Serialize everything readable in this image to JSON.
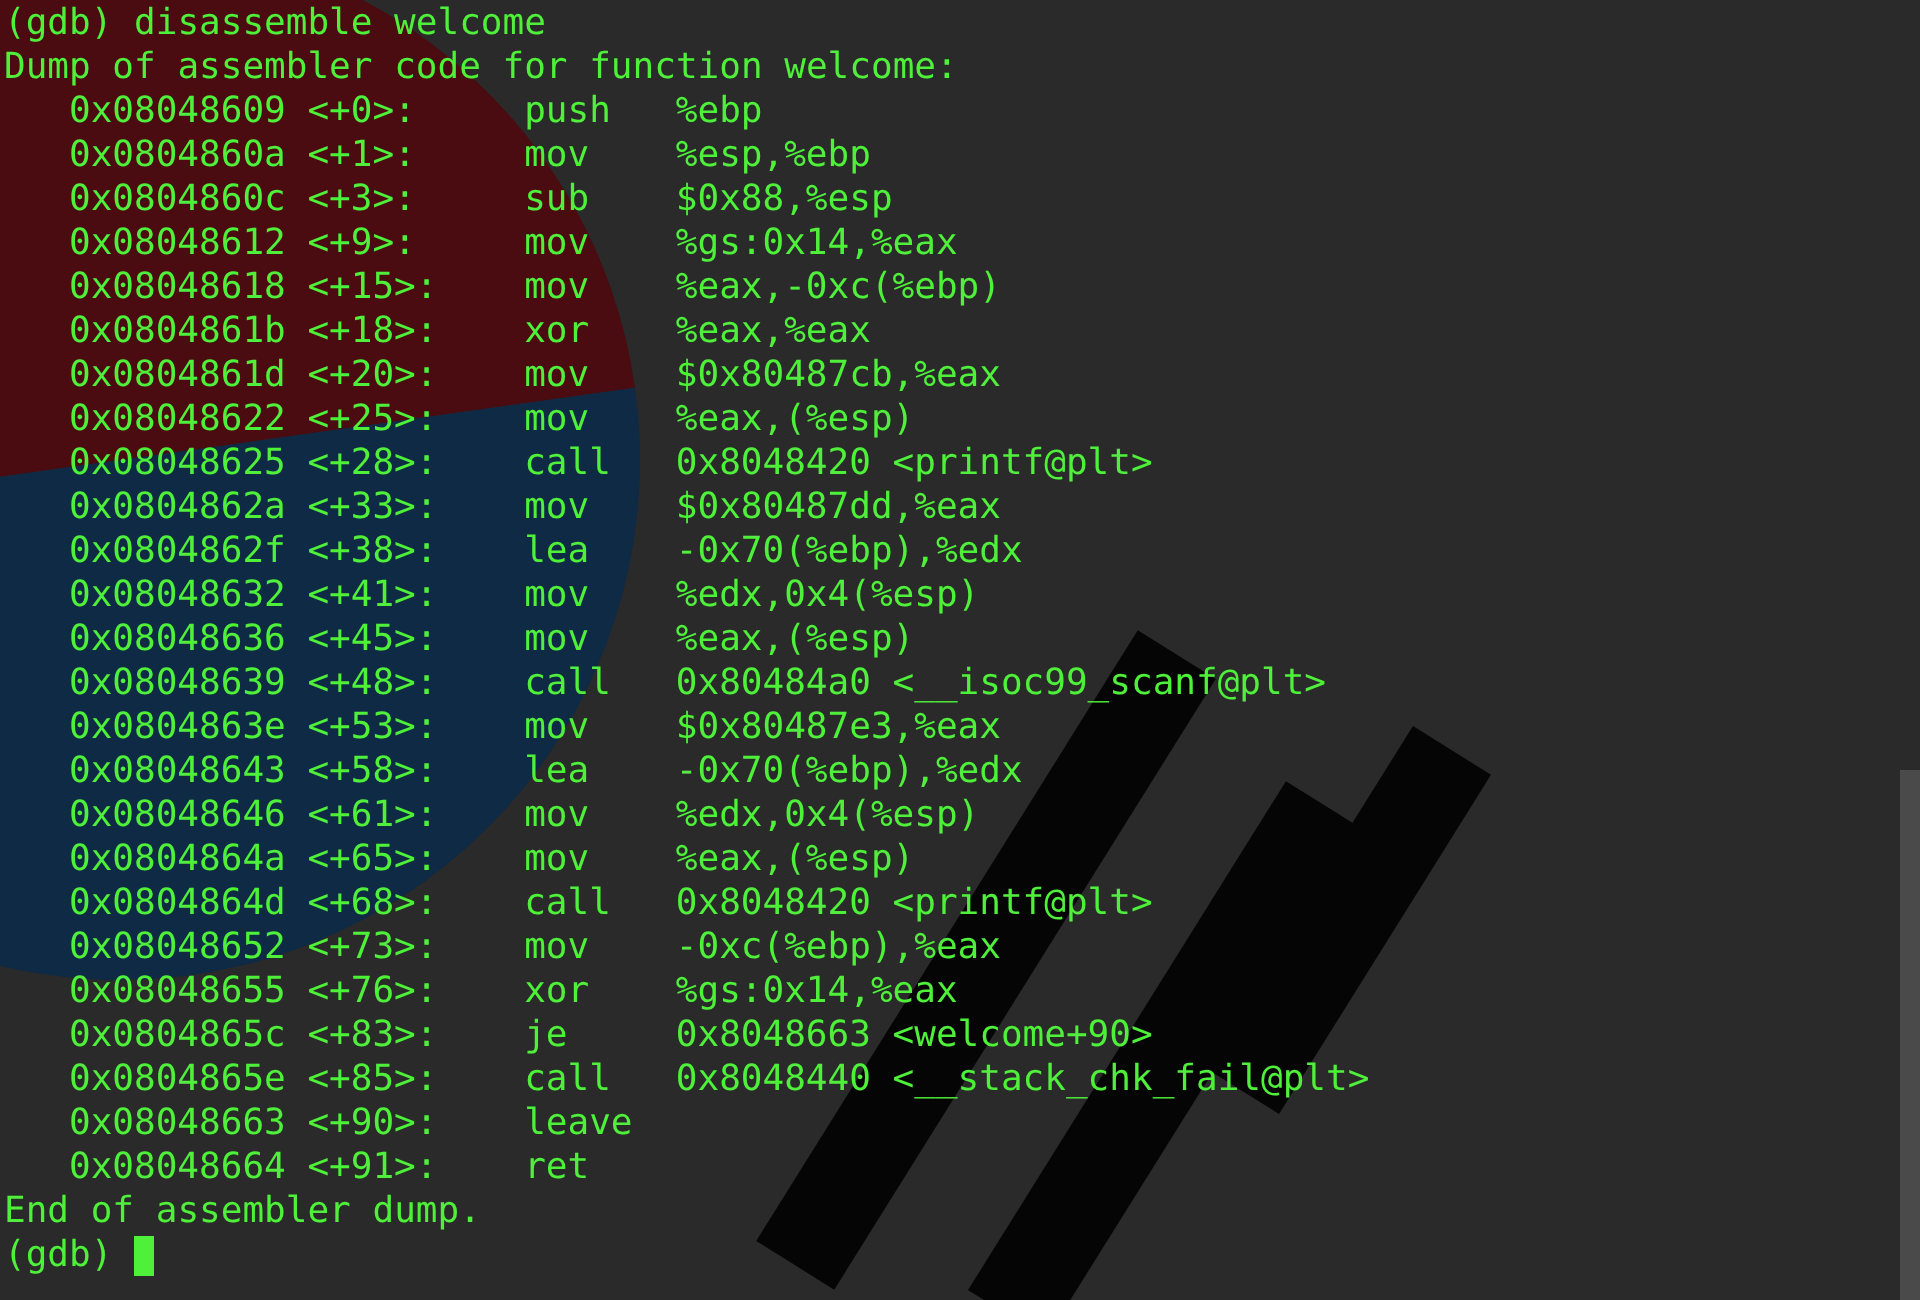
{
  "command_line": {
    "prompt": "(gdb)",
    "command": "disassemble welcome"
  },
  "header": "Dump of assembler code for function welcome:",
  "instructions": [
    {
      "address": "0x08048609",
      "offset": "<+0>:",
      "mnemonic": "push",
      "operands": "%ebp"
    },
    {
      "address": "0x0804860a",
      "offset": "<+1>:",
      "mnemonic": "mov",
      "operands": "%esp,%ebp"
    },
    {
      "address": "0x0804860c",
      "offset": "<+3>:",
      "mnemonic": "sub",
      "operands": "$0x88,%esp"
    },
    {
      "address": "0x08048612",
      "offset": "<+9>:",
      "mnemonic": "mov",
      "operands": "%gs:0x14,%eax"
    },
    {
      "address": "0x08048618",
      "offset": "<+15>:",
      "mnemonic": "mov",
      "operands": "%eax,-0xc(%ebp)"
    },
    {
      "address": "0x0804861b",
      "offset": "<+18>:",
      "mnemonic": "xor",
      "operands": "%eax,%eax"
    },
    {
      "address": "0x0804861d",
      "offset": "<+20>:",
      "mnemonic": "mov",
      "operands": "$0x80487cb,%eax"
    },
    {
      "address": "0x08048622",
      "offset": "<+25>:",
      "mnemonic": "mov",
      "operands": "%eax,(%esp)"
    },
    {
      "address": "0x08048625",
      "offset": "<+28>:",
      "mnemonic": "call",
      "operands": "0x8048420 <printf@plt>"
    },
    {
      "address": "0x0804862a",
      "offset": "<+33>:",
      "mnemonic": "mov",
      "operands": "$0x80487dd,%eax"
    },
    {
      "address": "0x0804862f",
      "offset": "<+38>:",
      "mnemonic": "lea",
      "operands": "-0x70(%ebp),%edx"
    },
    {
      "address": "0x08048632",
      "offset": "<+41>:",
      "mnemonic": "mov",
      "operands": "%edx,0x4(%esp)"
    },
    {
      "address": "0x08048636",
      "offset": "<+45>:",
      "mnemonic": "mov",
      "operands": "%eax,(%esp)"
    },
    {
      "address": "0x08048639",
      "offset": "<+48>:",
      "mnemonic": "call",
      "operands": "0x80484a0 <__isoc99_scanf@plt>"
    },
    {
      "address": "0x0804863e",
      "offset": "<+53>:",
      "mnemonic": "mov",
      "operands": "$0x80487e3,%eax"
    },
    {
      "address": "0x08048643",
      "offset": "<+58>:",
      "mnemonic": "lea",
      "operands": "-0x70(%ebp),%edx"
    },
    {
      "address": "0x08048646",
      "offset": "<+61>:",
      "mnemonic": "mov",
      "operands": "%edx,0x4(%esp)"
    },
    {
      "address": "0x0804864a",
      "offset": "<+65>:",
      "mnemonic": "mov",
      "operands": "%eax,(%esp)"
    },
    {
      "address": "0x0804864d",
      "offset": "<+68>:",
      "mnemonic": "call",
      "operands": "0x8048420 <printf@plt>"
    },
    {
      "address": "0x08048652",
      "offset": "<+73>:",
      "mnemonic": "mov",
      "operands": "-0xc(%ebp),%eax"
    },
    {
      "address": "0x08048655",
      "offset": "<+76>:",
      "mnemonic": "xor",
      "operands": "%gs:0x14,%eax"
    },
    {
      "address": "0x0804865c",
      "offset": "<+83>:",
      "mnemonic": "je",
      "operands": "0x8048663 <welcome+90>"
    },
    {
      "address": "0x0804865e",
      "offset": "<+85>:",
      "mnemonic": "call",
      "operands": "0x8048440 <__stack_chk_fail@plt>"
    },
    {
      "address": "0x08048663",
      "offset": "<+90>:",
      "mnemonic": "leave"
    },
    {
      "address": "0x08048664",
      "offset": "<+91>:",
      "mnemonic": "ret"
    }
  ],
  "footer": "End of assembler dump.",
  "input_line": {
    "prompt": "(gdb)"
  }
}
